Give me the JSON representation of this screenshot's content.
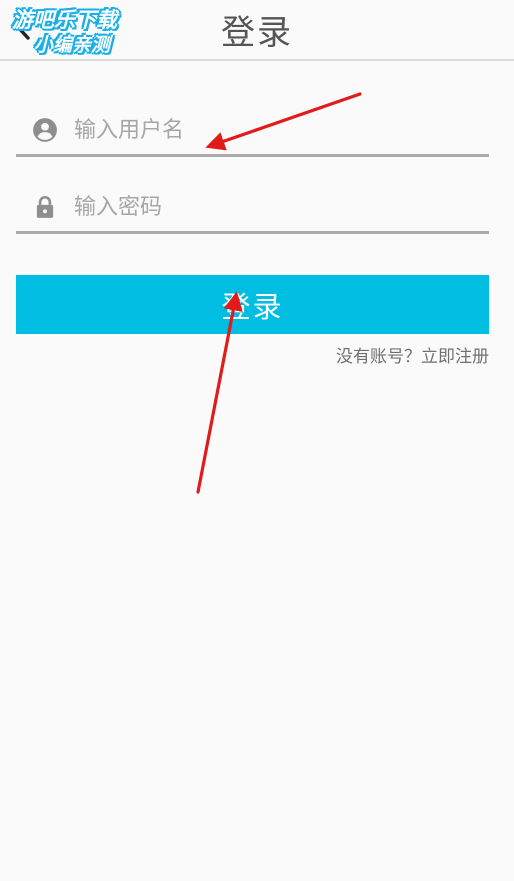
{
  "header": {
    "title": "登录",
    "back_icon": "chevron-left-icon"
  },
  "watermark": {
    "line1": "游吧乐下载",
    "line2": "小编亲测"
  },
  "form": {
    "username": {
      "icon": "account-circle-icon",
      "placeholder": "输入用户名",
      "value": ""
    },
    "password": {
      "icon": "lock-icon",
      "placeholder": "输入密码",
      "value": ""
    },
    "login_label": "登录",
    "register_text": "没有账号？立即注册"
  },
  "colors": {
    "accent": "#00bde2",
    "background": "#fafafa",
    "underline": "#aaaaaa",
    "annotation_arrow": "#e11a1a"
  }
}
